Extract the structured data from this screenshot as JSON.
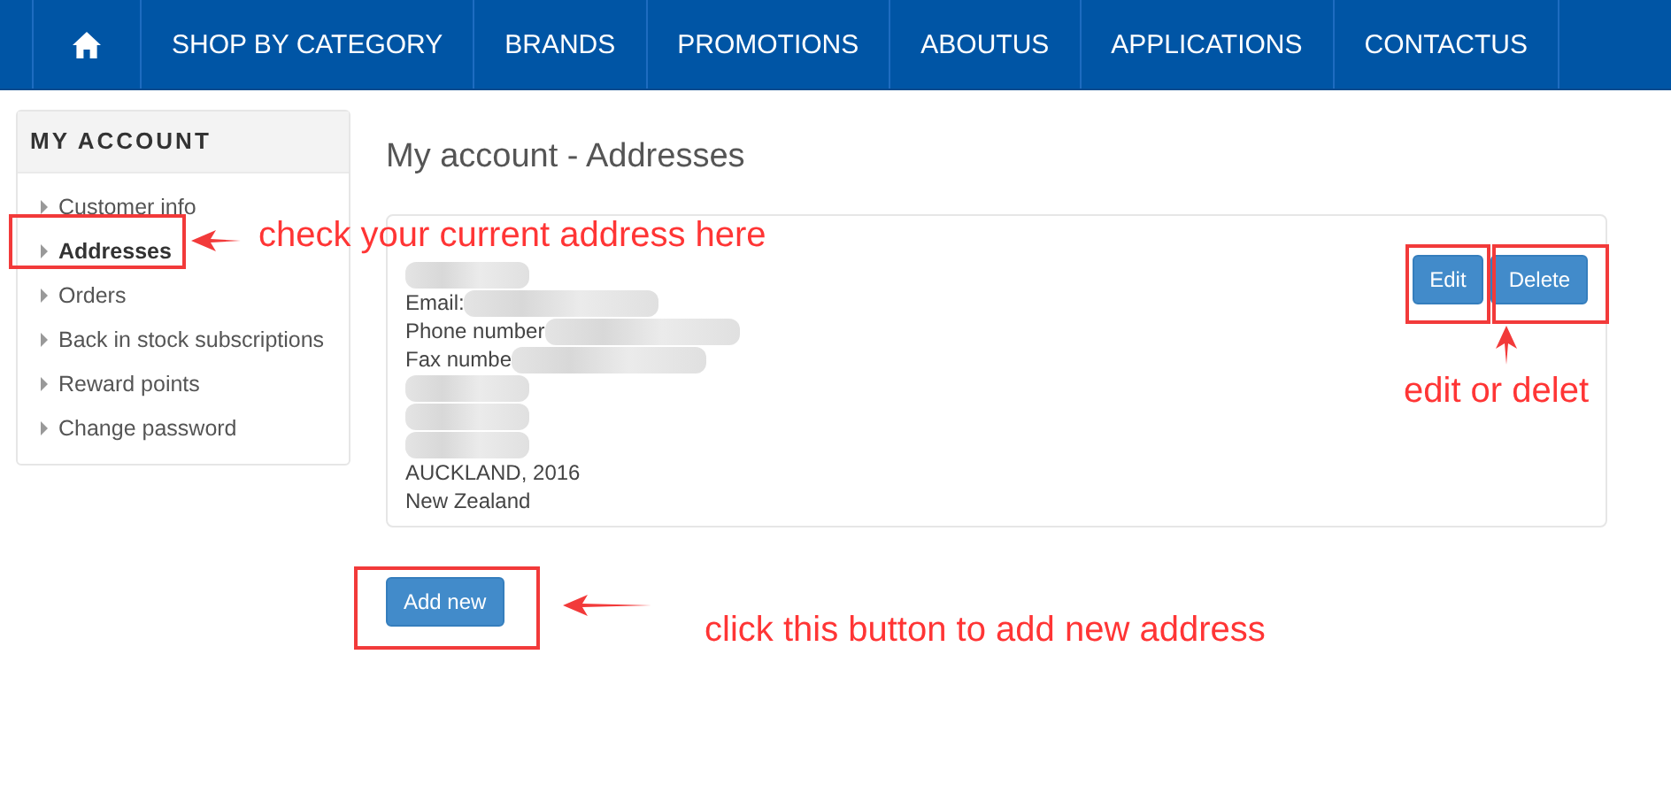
{
  "nav": {
    "items": [
      {
        "kind": "home"
      },
      {
        "kind": "link",
        "label": "SHOP BY CATEGORY"
      },
      {
        "kind": "link",
        "label": "BRANDS"
      },
      {
        "kind": "link",
        "label": "PROMOTIONS"
      },
      {
        "kind": "link",
        "label": "ABOUTUS"
      },
      {
        "kind": "link",
        "label": "APPLICATIONS"
      },
      {
        "kind": "link",
        "label": "CONTACTUS"
      }
    ]
  },
  "sidebar": {
    "title": "MY ACCOUNT",
    "items": [
      {
        "label": "Customer info",
        "selected": false
      },
      {
        "label": "Addresses",
        "selected": true
      },
      {
        "label": "Orders",
        "selected": false
      },
      {
        "label": "Back in stock subscriptions",
        "selected": false
      },
      {
        "label": "Reward points",
        "selected": false
      },
      {
        "label": "Change password",
        "selected": false
      }
    ]
  },
  "page_title": "My account - Addresses",
  "address": {
    "lines": [
      {
        "kind": "blurred"
      },
      {
        "kind": "partial",
        "text": "Email:"
      },
      {
        "kind": "partial",
        "text": "Phone number"
      },
      {
        "kind": "partial",
        "text": "Fax numbe"
      },
      {
        "kind": "blurred"
      },
      {
        "kind": "blurred"
      },
      {
        "kind": "blurred"
      },
      {
        "kind": "text",
        "text": "AUCKLAND, 2016"
      },
      {
        "kind": "text",
        "text": "New Zealand"
      }
    ],
    "buttons": [
      "Edit",
      "Delete"
    ]
  },
  "add_button": "Add new",
  "annotations": [
    "check your current address here",
    "edit or delet",
    "click this button to add new address"
  ]
}
